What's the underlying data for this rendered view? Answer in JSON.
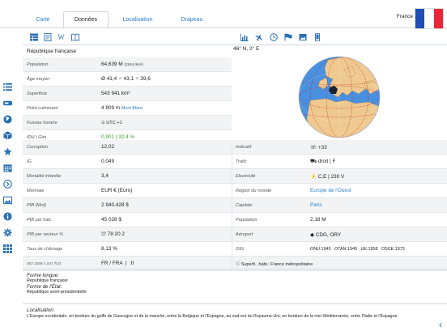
{
  "tabs": [
    {
      "label": "Carte",
      "active": false
    },
    {
      "label": "Données",
      "active": true
    },
    {
      "label": "Localisation",
      "active": false
    },
    {
      "label": "Drapeau",
      "active": false
    }
  ],
  "header": {
    "country": "France",
    "flag_colors": [
      "#1f4fb5",
      "#ffffff",
      "#e8283a"
    ]
  },
  "sidebar_icons": [
    "list-icon",
    "drive-icon",
    "globe-icon",
    "cube-icon",
    "star-icon",
    "calendar-icon",
    "chevron-circle-icon",
    "image-icon",
    "info-icon",
    "gear-icon",
    "grid-icon"
  ],
  "toolbar_left_icons": [
    "table-icon",
    "document-icon",
    "wikipedia-icon",
    "book-icon"
  ],
  "toolbar_right_icons": [
    "bar-chart-icon",
    "airplane-icon",
    "clock-icon",
    "flag-icon",
    "picture-icon",
    "phone-icon"
  ],
  "full_name": "République française",
  "coordinates": "46° N, 2° E",
  "rows_left": [
    {
      "label": "Population",
      "value": "64,639 M",
      "note": "(118,6 /km²)"
    },
    {
      "label": "Âge moyen",
      "value": "Ø 41,4  ♂ 43,1  ♀ 39,6"
    },
    {
      "label": "Superficie",
      "value": "543 941 km²"
    },
    {
      "label": "Point culminant",
      "value": "4 809 m",
      "link": "Mont Blanc"
    },
    {
      "label": "Fuseau horaire",
      "value": "UTC +1"
    },
    {
      "label": "IDH | Gini",
      "value": "0,901 | 32,4 %"
    }
  ],
  "rows_both": [
    {
      "l_label": "Corruption",
      "l_value": "12,02",
      "r_label": "Indicatif",
      "r_value": "+33"
    },
    {
      "l_label": "IG",
      "l_value": "0,049",
      "r_label": "Trafic",
      "r_value": "droit | F"
    },
    {
      "l_label": "Mortalité infantile",
      "l_value": "3,4",
      "r_label": "Electricité",
      "r_value": "C,E | 230 V"
    },
    {
      "l_label": "Monnaie",
      "l_value": "EUR € (Euro)",
      "r_label": "Région du monde",
      "r_value": "Europe de l'Ouest"
    },
    {
      "l_label": "PIB (Mrd)",
      "l_value": "2 940,428 $",
      "r_label": "Capitale",
      "r_value": "Paris"
    },
    {
      "l_label": "PIB par hab.",
      "l_value": "45 028 $",
      "r_label": "Population",
      "r_value": "2,18 M"
    },
    {
      "l_label": "PIB par secteur %",
      "l_value": "78  20  2",
      "r_label": "Aéroport",
      "r_value": "CDG, ORY"
    },
    {
      "l_label": "Taux de chômage",
      "l_value": "8,13 %",
      "r_label": "OIG",
      "r_value": "ONU:1945   OTAN:1949   UE:1958   OSCE:1973"
    },
    {
      "l_label": "ISO 3166-1 a3 | TLD",
      "l_value": "FR / FRA  |  .fr",
      "r_label": "",
      "r_value": "Superfi., habi.: France métropolitaine"
    }
  ],
  "forme": {
    "longue_label": "Forme longue:",
    "longue_value": "République française",
    "etat_label": "Forme de l'État:",
    "etat_value": "République semi-présidentielle"
  },
  "localisation": {
    "label": "Localisation:",
    "value": "L'Europe occidentale, en bordure du golfe de Gascogne et de la manche, entre la Belgique et l'Espagne, au sud-est du Royaume-Uni; en bordure de la mer Méditerranée, entre l'Italie et l'Espagne"
  }
}
